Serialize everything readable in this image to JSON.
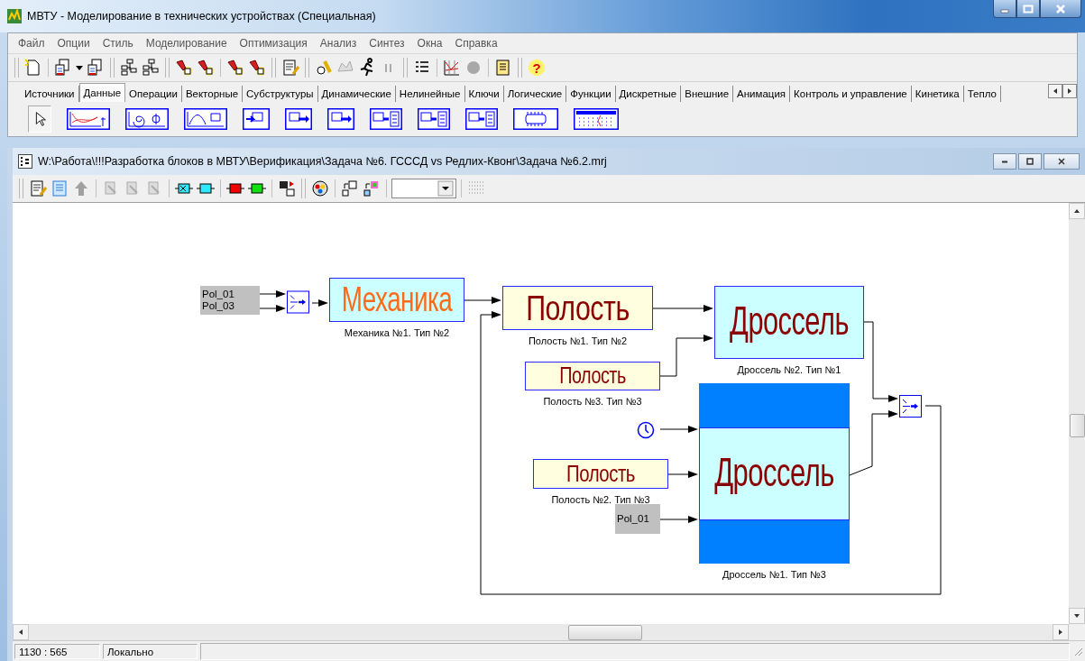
{
  "window": {
    "title": "МВТУ - Моделирование в технических устройствах (Специальная)"
  },
  "menu": [
    "Файл",
    "Опции",
    "Стиль",
    "Моделирование",
    "Оптимизация",
    "Анализ",
    "Синтез",
    "Окна",
    "Справка"
  ],
  "toolbar": {
    "help": "?"
  },
  "palette_tabs": [
    {
      "label": "Источники",
      "selected": false
    },
    {
      "label": "Данные",
      "selected": true
    },
    {
      "label": "Операции",
      "selected": false
    },
    {
      "label": "Векторные",
      "selected": false
    },
    {
      "label": "Субструктуры",
      "selected": false
    },
    {
      "label": "Динамические",
      "selected": false
    },
    {
      "label": "Нелинейные",
      "selected": false
    },
    {
      "label": "Ключи",
      "selected": false
    },
    {
      "label": "Логические",
      "selected": false
    },
    {
      "label": "Функции",
      "selected": false
    },
    {
      "label": "Дискретные",
      "selected": false
    },
    {
      "label": "Внешние",
      "selected": false
    },
    {
      "label": "Анимация",
      "selected": false
    },
    {
      "label": "Контроль и управление",
      "selected": false
    },
    {
      "label": "Кинетика",
      "selected": false
    },
    {
      "label": "Тепло",
      "selected": false
    }
  ],
  "document": {
    "title": "W:\\Работа\\!!!Разработка блоков в МВТУ\\Верификация\\Задача №6. ГСССД vs Редлих-Квонг\\Задача №6.2.mrj"
  },
  "diagram": {
    "blocks": [
      {
        "kind": "signal",
        "lines": [
          "Pol_01",
          "Pol_03"
        ]
      },
      {
        "kind": "mux"
      },
      {
        "kind": "mechanics",
        "label": "Механика",
        "caption": "Механика №1. Тип №2"
      },
      {
        "kind": "cavity",
        "label": "Полость",
        "caption": "Полость №1. Тип №2"
      },
      {
        "kind": "throttle",
        "label": "Дроссель",
        "caption": "Дроссель №2. Тип №1"
      },
      {
        "kind": "cavity",
        "label": "Полость",
        "caption": "Полость №3. Тип №3"
      },
      {
        "kind": "clock"
      },
      {
        "kind": "cavity",
        "label": "Полость",
        "caption": "Полость №2. Тип №3"
      },
      {
        "kind": "signal",
        "lines": [
          "Pol_01"
        ]
      },
      {
        "kind": "throttle_framed",
        "label": "Дроссель",
        "caption": "Дроссель №1. Тип №3"
      },
      {
        "kind": "mux"
      }
    ]
  },
  "status_bar": [
    "1130 : 565",
    "Локально"
  ]
}
